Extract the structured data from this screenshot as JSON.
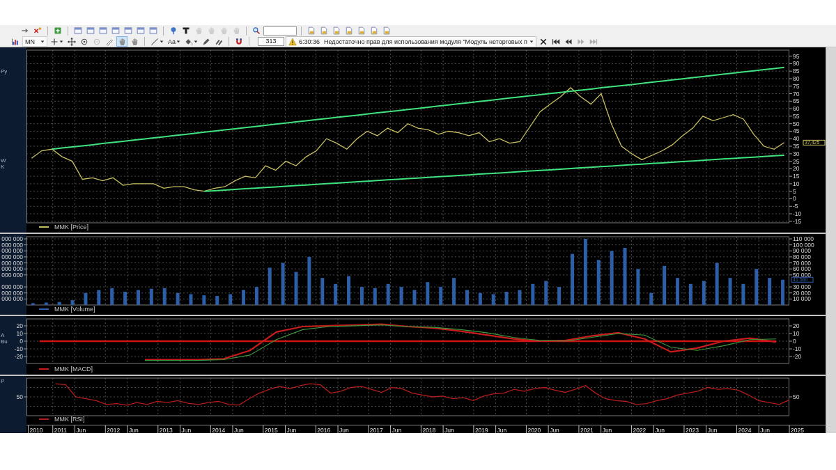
{
  "toolbar_top": [
    {
      "kind": "button",
      "disabled": false
    },
    {
      "kind": "button",
      "disabled": false
    },
    {
      "kind": "separator"
    },
    {
      "kind": "button",
      "disabled": false
    },
    {
      "kind": "separator"
    },
    {
      "kind": "button",
      "disabled": false
    },
    {
      "kind": "button",
      "disabled": false
    },
    {
      "kind": "button",
      "disabled": false
    },
    {
      "kind": "button",
      "disabled": false
    },
    {
      "kind": "button",
      "disabled": false
    },
    {
      "kind": "button",
      "disabled": false
    },
    {
      "kind": "button",
      "disabled": false
    },
    {
      "kind": "separator"
    },
    {
      "kind": "button",
      "disabled": false
    },
    {
      "kind": "button",
      "disabled": false
    },
    {
      "kind": "button",
      "disabled": true
    },
    {
      "kind": "button",
      "disabled": true
    },
    {
      "kind": "button",
      "disabled": true
    },
    {
      "kind": "button",
      "disabled": true
    },
    {
      "kind": "separator"
    },
    {
      "kind": "button",
      "disabled": false
    },
    {
      "kind": "field"
    },
    {
      "kind": "separator"
    },
    {
      "kind": "button",
      "disabled": false
    },
    {
      "kind": "button",
      "disabled": false
    },
    {
      "kind": "button",
      "disabled": false
    },
    {
      "kind": "button",
      "disabled": false
    },
    {
      "kind": "button",
      "disabled": false
    },
    {
      "kind": "button",
      "disabled": false
    },
    {
      "kind": "button",
      "disabled": false
    }
  ],
  "toolbar_bottom": [
    {
      "kind": "button",
      "disabled": false,
      "selected": false
    },
    {
      "kind": "dropdown",
      "value": "MN"
    },
    {
      "kind": "menu-button",
      "disabled": false,
      "selected": false
    },
    {
      "kind": "button",
      "disabled": false,
      "selected": false
    },
    {
      "kind": "button",
      "disabled": false,
      "selected": false
    },
    {
      "kind": "button",
      "disabled": true,
      "selected": false
    },
    {
      "kind": "button",
      "disabled": false,
      "selected": false
    },
    {
      "kind": "button",
      "disabled": false,
      "selected": true
    },
    {
      "kind": "button",
      "disabled": false,
      "selected": false
    },
    {
      "kind": "separator"
    },
    {
      "kind": "menu-button",
      "disabled": false,
      "selected": false
    },
    {
      "kind": "menu-button",
      "label": "Aa",
      "disabled": false,
      "selected": false
    },
    {
      "kind": "menu-button",
      "disabled": false,
      "selected": false
    },
    {
      "kind": "button",
      "disabled": false,
      "selected": false
    },
    {
      "kind": "button",
      "disabled": false,
      "selected": false
    },
    {
      "kind": "separator"
    },
    {
      "kind": "button",
      "disabled": false,
      "selected": false
    },
    {
      "kind": "separator"
    },
    {
      "kind": "field",
      "value": "313"
    },
    {
      "kind": "message",
      "time": "6:30:36",
      "text": "Недостаточно прав для использования модуля \"Модуль неторговых п"
    },
    {
      "kind": "button",
      "disabled": false,
      "selected": false
    },
    {
      "kind": "button",
      "disabled": false,
      "selected": false
    },
    {
      "kind": "button",
      "disabled": false,
      "selected": false
    },
    {
      "kind": "button",
      "disabled": true,
      "selected": false
    },
    {
      "kind": "button",
      "disabled": true,
      "selected": false
    }
  ],
  "price_panel": {
    "sidebar_fragments": [
      "Py",
      "W",
      "K"
    ],
    "chart_data": {
      "type": "line",
      "categories": [
        null,
        null,
        null,
        null,
        null,
        null,
        null,
        null,
        null,
        null,
        null,
        null,
        null,
        null,
        null,
        null,
        null,
        null,
        null,
        null,
        null,
        null,
        null,
        null,
        null,
        null,
        null,
        null,
        null,
        null,
        null,
        null,
        null,
        null,
        null,
        null,
        null,
        null,
        null,
        null,
        null,
        null,
        null,
        null,
        null,
        null,
        null,
        null,
        null,
        null,
        null,
        null,
        null,
        null,
        null,
        null,
        null,
        null,
        null,
        null,
        null,
        null,
        null,
        null,
        null,
        null,
        null,
        null,
        null,
        null,
        null,
        null,
        null,
        null,
        null
      ],
      "series": [
        {
          "name": "MMK [Price]",
          "color": "#c8c060",
          "values": [
            27,
            32,
            33,
            28,
            25,
            13,
            14,
            12,
            14,
            9,
            10,
            10,
            10,
            7,
            8,
            8,
            6,
            5,
            7,
            8,
            12,
            15,
            14,
            22,
            19,
            25,
            22,
            28,
            32,
            40,
            37,
            33,
            40,
            45,
            42,
            47,
            44,
            50,
            47,
            46,
            43,
            45,
            44,
            42,
            44,
            38,
            40,
            37,
            38,
            48,
            58,
            63,
            68,
            74,
            68,
            63,
            70,
            50,
            35,
            30,
            26,
            29,
            32,
            36,
            42,
            47,
            55,
            52,
            54,
            56,
            53,
            43,
            35,
            33,
            37.4
          ]
        },
        {
          "color": "#3fe27e",
          "values": [
            null,
            null,
            33.0,
            33.8,
            34.5,
            35.3,
            36.0,
            36.8,
            37.5,
            38.3,
            39.1,
            39.8,
            40.6,
            41.3,
            42.1,
            42.8,
            43.6,
            44.4,
            45.1,
            45.9,
            46.6,
            47.4,
            48.1,
            48.9,
            49.7,
            50.4,
            51.2,
            51.9,
            52.7,
            53.4,
            54.2,
            54.9,
            55.7,
            56.5,
            57.2,
            58.0,
            58.7,
            59.5,
            60.2,
            61.0,
            61.8,
            62.5,
            63.3,
            64.0,
            64.8,
            65.5,
            66.3,
            67.1,
            67.8,
            68.6,
            69.3,
            70.1,
            70.8,
            71.6,
            72.4,
            73.1,
            73.9,
            74.6,
            75.4,
            76.1,
            76.9,
            77.7,
            78.4,
            79.2,
            79.9,
            80.7,
            81.4,
            82.2,
            83.0,
            83.7,
            84.5,
            85.2,
            86.0,
            86.7,
            87.5
          ]
        },
        {
          "color": "#3fe27e",
          "values": [
            null,
            null,
            null,
            null,
            null,
            null,
            null,
            null,
            null,
            null,
            null,
            null,
            null,
            null,
            null,
            null,
            null,
            5.0,
            5.4,
            5.8,
            6.3,
            6.7,
            7.1,
            7.5,
            7.9,
            8.4,
            8.8,
            9.2,
            9.6,
            10.1,
            10.5,
            10.9,
            11.3,
            11.7,
            12.2,
            12.6,
            13.0,
            13.4,
            13.8,
            14.3,
            14.7,
            15.1,
            15.5,
            15.9,
            16.4,
            16.8,
            17.2,
            17.6,
            18.1,
            18.5,
            18.9,
            19.3,
            19.7,
            20.2,
            20.6,
            21.0,
            21.4,
            21.8,
            22.3,
            22.7,
            23.1,
            23.5,
            23.9,
            24.4,
            24.8,
            25.2,
            25.6,
            26.1,
            26.5,
            26.9,
            27.3,
            27.7,
            28.2,
            28.6,
            29.0
          ]
        }
      ],
      "ylim": [
        -16,
        99
      ],
      "grid": true,
      "yticks": [
        -15,
        -10,
        -5,
        0,
        5,
        10,
        15,
        20,
        25,
        30,
        35,
        40,
        45,
        50,
        55,
        60,
        65,
        70,
        75,
        80,
        85,
        90,
        95
      ],
      "annotations": [
        {
          "text": "37,425"
        }
      ]
    }
  },
  "volume_panel": {
    "left_labels": [
      "000 000",
      "000 000",
      "000 000",
      "000 000",
      "000 000",
      "000 000",
      "000 000",
      "000 000",
      "000 000",
      "000 000"
    ],
    "chart_data": {
      "type": "bar",
      "categories": [
        null,
        null,
        null,
        null,
        null,
        null,
        null,
        null,
        null,
        null,
        null,
        null,
        null,
        null,
        null,
        null,
        null,
        null,
        null,
        null,
        null,
        null,
        null,
        null,
        null,
        null,
        null,
        null,
        null,
        null,
        null,
        null,
        null,
        null,
        null,
        null,
        null,
        null,
        null,
        null,
        null,
        null,
        null,
        null,
        null,
        null,
        null,
        null,
        null,
        null,
        null,
        null,
        null,
        null,
        null,
        null,
        null,
        null
      ],
      "series": [
        {
          "name": "MMK [Volume]",
          "color": "#2d5ea8",
          "values": [
            3000,
            4000,
            5000,
            8000,
            20000,
            25000,
            28000,
            22000,
            25000,
            27000,
            28000,
            20000,
            18000,
            16000,
            15000,
            18000,
            25000,
            30000,
            62000,
            70000,
            55000,
            80000,
            45000,
            35000,
            48000,
            30000,
            28000,
            35000,
            30000,
            25000,
            38000,
            30000,
            45000,
            25000,
            20000,
            18000,
            22000,
            25000,
            35000,
            40000,
            30000,
            85000,
            110000,
            75000,
            90000,
            95000,
            60000,
            20000,
            65000,
            45000,
            35000,
            40000,
            70000,
            45000,
            35000,
            60000,
            45000,
            42000
          ]
        }
      ],
      "ylim": [
        0,
        113500
      ],
      "grid": true,
      "yticks": [
        {
          "value": 10000,
          "label": "10 000"
        },
        {
          "value": 20000,
          "label": "20 000"
        },
        {
          "value": 30000,
          "label": "30 000"
        },
        {
          "value": 50000,
          "label": "50 000"
        },
        {
          "value": 60000,
          "label": "60 000"
        },
        {
          "value": 70000,
          "label": "70 000"
        },
        {
          "value": 80000,
          "label": "80 000"
        },
        {
          "value": 90000,
          "label": "90 000"
        },
        {
          "value": 100000,
          "label": "100 000"
        },
        {
          "value": 110000,
          "label": "110 000"
        }
      ],
      "annotations": [
        {
          "text": "41 580"
        }
      ]
    }
  },
  "macd_panel": {
    "sidebar_fragments": [
      "A",
      "Bu"
    ],
    "left_labels": [
      "20",
      "10",
      "0",
      "-10",
      "-20"
    ],
    "chart_data": {
      "type": "line",
      "categories": [
        null,
        null,
        null,
        null,
        null,
        null,
        null,
        null,
        null,
        null,
        null,
        null,
        null,
        null,
        null,
        null,
        null,
        null,
        null,
        null,
        null,
        null,
        null,
        null,
        null,
        null,
        null,
        null,
        null
      ],
      "series": [
        {
          "name": "MMK [MACD]",
          "color": "#c81c1c",
          "values": [
            null,
            null,
            null,
            null,
            -24,
            -24,
            -24,
            -23,
            -12,
            12,
            19,
            20,
            21,
            22,
            19,
            17,
            13,
            8,
            3,
            0,
            1,
            7,
            11,
            3,
            -14,
            -9,
            0,
            4,
            -1
          ]
        },
        {
          "color": "#3d9a3d",
          "values": [
            null,
            null,
            null,
            null,
            -25,
            -25,
            -25,
            -24,
            -18,
            2,
            15,
            19,
            20,
            21,
            19,
            18,
            15,
            11,
            5,
            1,
            0,
            5,
            10,
            8,
            -8,
            -12,
            -6,
            2,
            3
          ]
        },
        {
          "color": "#d01414",
          "values": [
            0,
            0,
            0,
            0,
            0,
            0,
            0,
            0,
            0,
            0,
            0,
            0,
            0,
            0,
            0,
            0,
            0,
            0,
            0,
            0,
            0,
            0,
            0,
            0,
            0,
            0,
            0,
            0,
            0
          ]
        }
      ],
      "ylim": [
        -29,
        29
      ],
      "grid": true,
      "yticks": [
        -20,
        -10,
        0,
        10,
        20
      ]
    }
  },
  "rsi_panel": {
    "sidebar_fragments": [
      "P"
    ],
    "left_labels": [
      "50"
    ],
    "right_labels": [
      "50"
    ],
    "legend": {
      "label": "MMK [RSI]",
      "color": "#b41c1c"
    }
  },
  "time_axis": {
    "labels": [
      "2010",
      "2011",
      "Jun",
      "2012",
      "Jun",
      "2013",
      "Jun",
      "2014",
      "Jun",
      "2015",
      "Jun",
      "2016",
      "Jun",
      "2017",
      "Jun",
      "2018",
      "Jun",
      "2019",
      "Jun",
      "2020",
      "Jun",
      "2021",
      "Jun",
      "2022",
      "Jun",
      "2023",
      "Jun",
      "2024",
      "Jun",
      "2025"
    ]
  }
}
